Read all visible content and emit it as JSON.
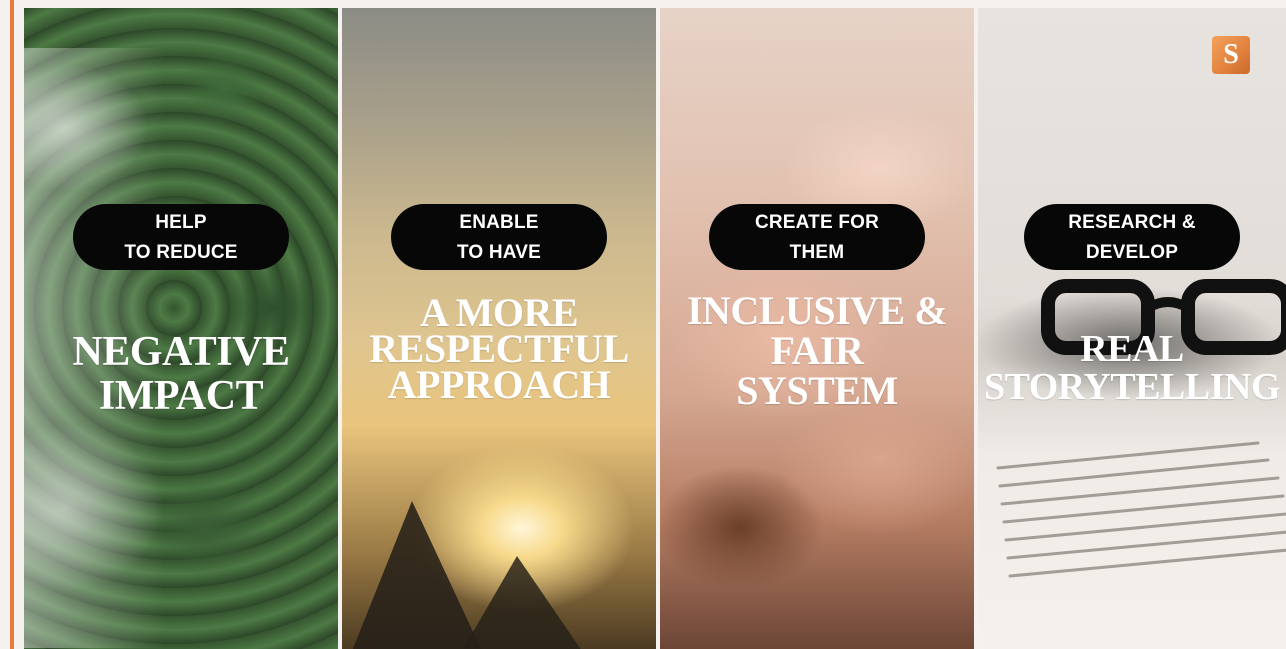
{
  "panels": [
    {
      "pill_lines": [
        "HELP",
        "TO REDUCE"
      ],
      "headline_lines": [
        "NEGATIVE",
        "IMPACT"
      ]
    },
    {
      "pill_lines": [
        "ENABLE",
        "TO HAVE"
      ],
      "headline_lines": [
        "A MORE",
        "RESPECTFUL",
        "APPROACH"
      ]
    },
    {
      "pill_lines": [
        "CREATE FOR",
        "THEM"
      ],
      "headline_lines": [
        "INCLUSIVE &",
        "FAIR",
        "SYSTEM"
      ]
    },
    {
      "pill_lines": [
        "RESEARCH &",
        "DEVELOP"
      ],
      "headline_lines": [
        "REAL",
        "STORYTELLING"
      ]
    }
  ],
  "brand": {
    "logo_letter": "S",
    "accent_color": "#e77b3c"
  },
  "icons": [
    "brand-logo-icon"
  ]
}
